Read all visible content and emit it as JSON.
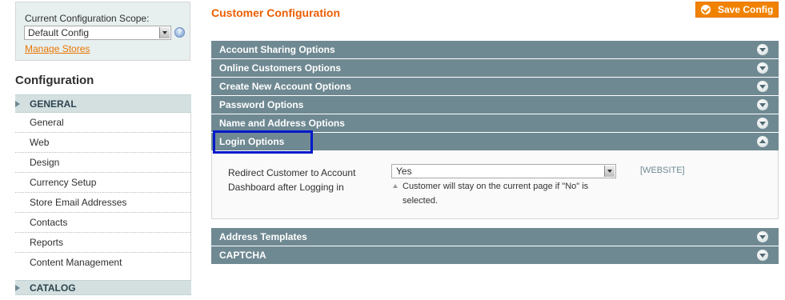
{
  "scope": {
    "label": "Current Configuration Scope:",
    "selected": "Default Config",
    "manage_link": "Manage Stores",
    "help_icon": "help-icon"
  },
  "sidebar": {
    "title": "Configuration",
    "sections": [
      {
        "label": "GENERAL",
        "items": [
          "General",
          "Web",
          "Design",
          "Currency Setup",
          "Store Email Addresses",
          "Contacts",
          "Reports",
          "Content Management"
        ]
      },
      {
        "label": "CATALOG",
        "items": []
      }
    ]
  },
  "main": {
    "title": "Customer Configuration",
    "save_button": "Save Config",
    "sections": [
      {
        "label": "Account Sharing Options",
        "state": "collapsed"
      },
      {
        "label": "Online Customers Options",
        "state": "collapsed"
      },
      {
        "label": "Create New Account Options",
        "state": "collapsed"
      },
      {
        "label": "Password Options",
        "state": "collapsed"
      },
      {
        "label": "Name and Address Options",
        "state": "collapsed"
      },
      {
        "label": "Login Options",
        "state": "expanded"
      },
      {
        "label": "Address Templates",
        "state": "collapsed"
      },
      {
        "label": "CAPTCHA",
        "state": "collapsed"
      }
    ],
    "login_options": {
      "field_label": "Redirect Customer to Account Dashboard after Logging in",
      "value": "Yes",
      "note": "Customer will stay on the current page if \"No\" is selected.",
      "scope": "[WEBSITE]"
    }
  },
  "colors": {
    "accent": "#eb5e00",
    "button": "#f18200",
    "section_header": "#6f8992",
    "highlight": "#0019cc"
  }
}
